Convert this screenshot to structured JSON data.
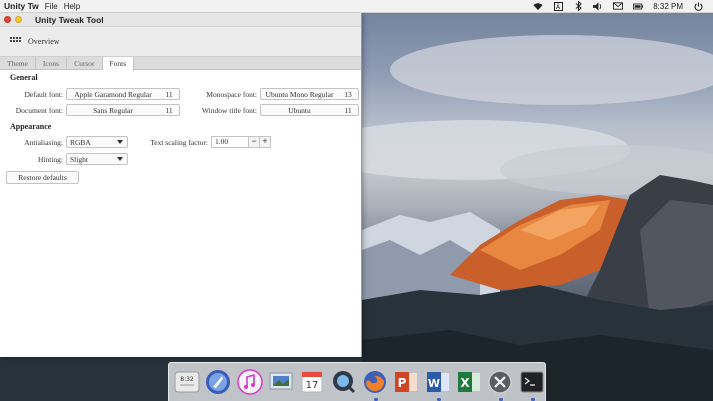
{
  "top_panel": {
    "app_name": "Unity Tw",
    "menus": [
      "File",
      "Help"
    ],
    "clock": "8:32 PM",
    "tray_icons": [
      "wifi-icon",
      "keyboard-layout-icon",
      "bluetooth-icon",
      "volume-icon",
      "mail-icon",
      "battery-icon",
      "power-icon"
    ]
  },
  "window": {
    "title": "Unity Tweak Tool",
    "toolbar": {
      "overview_label": "Overview"
    },
    "tabs": [
      {
        "label": "Theme",
        "active": false
      },
      {
        "label": "Icons",
        "active": false
      },
      {
        "label": "Cursor",
        "active": false
      },
      {
        "label": "Fonts",
        "active": true
      }
    ],
    "general": {
      "title": "General",
      "default_font": {
        "label": "Default font:",
        "name": "Apple Garamond Regular",
        "size": "11"
      },
      "document_font": {
        "label": "Document font:",
        "name": "Sans Regular",
        "size": "11"
      },
      "monospace_font": {
        "label": "Monospace font:",
        "name": "Ubuntu Mono Regular",
        "size": "13"
      },
      "window_title_font": {
        "label": "Window title font:",
        "name": "Ubuntu",
        "size": "11"
      }
    },
    "appearance": {
      "title": "Appearance",
      "antialiasing": {
        "label": "Antialiasing:",
        "value": "RGBA"
      },
      "hinting": {
        "label": "Hinting:",
        "value": "Slight"
      },
      "text_scaling": {
        "label": "Text scaling factor:",
        "value": "1.00",
        "minus": "−",
        "plus": "+"
      }
    },
    "restore_label": "Restore defaults"
  },
  "dock": {
    "clock_icon_text": "8:32",
    "calendar_day": "17",
    "items": [
      "clock-icon",
      "launchpad-icon",
      "itunes-icon",
      "photos-icon",
      "calendar-icon",
      "quicktime-icon",
      "firefox-icon",
      "powerpoint-icon",
      "word-icon",
      "excel-icon",
      "close-app-icon",
      "terminal-icon"
    ]
  }
}
